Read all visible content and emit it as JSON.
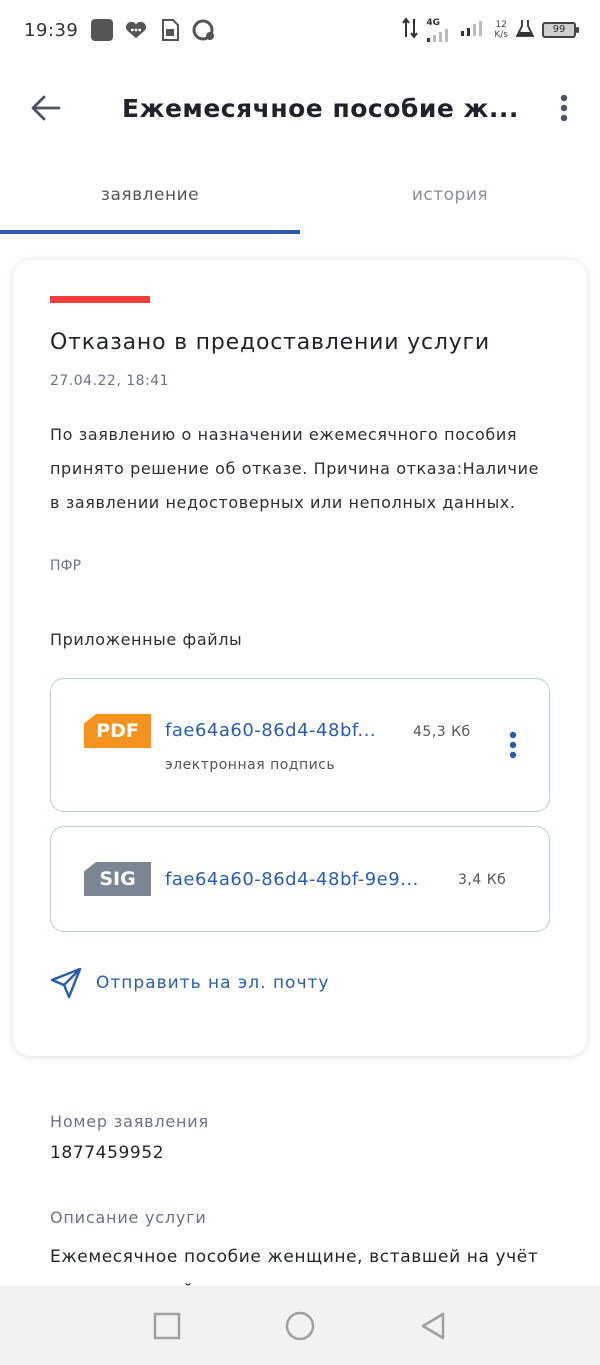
{
  "status_bar": {
    "time": "19:39",
    "network": "4G",
    "speed_value": "12",
    "speed_unit": "K/s",
    "battery": "99"
  },
  "header": {
    "title": "Ежемесячное пособие ж..."
  },
  "tabs": [
    {
      "label": "заявление",
      "active": true
    },
    {
      "label": "история",
      "active": false
    }
  ],
  "status_card": {
    "stripe_color": "#ee3f3a",
    "title": "Отказано в предоставлении услуги",
    "date": "27.04.22, 18:41",
    "text": "По заявлению о назначении ежемесячного пособия принято решение об отказе. Причина отказа:Наличие в заявлении недостоверных или неполных данных.",
    "source": "ПФР"
  },
  "files": {
    "heading": "Приложенные файлы",
    "items": [
      {
        "badge": "PDF",
        "badge_color": "#f5931e",
        "name": "fae64a60-86d4-48bf...",
        "size": "45,3 Кб",
        "sub": "электронная подпись"
      },
      {
        "badge": "SIG",
        "badge_color": "#7b8693",
        "name": "fae64a60-86d4-48bf-9e9...",
        "size": "3,4 Кб"
      }
    ]
  },
  "send": {
    "label": "Отправить на эл. почту"
  },
  "details": {
    "number_label": "Номер заявления",
    "number_value": "1877459952",
    "desc_label": "Описание услуги",
    "desc_value": "Ежемесячное пособие женщине, вставшей на учёт в медицинской организации в ранние сроки беременности"
  },
  "colors": {
    "accent": "#2b5cab",
    "status_red": "#ee3f3a"
  }
}
